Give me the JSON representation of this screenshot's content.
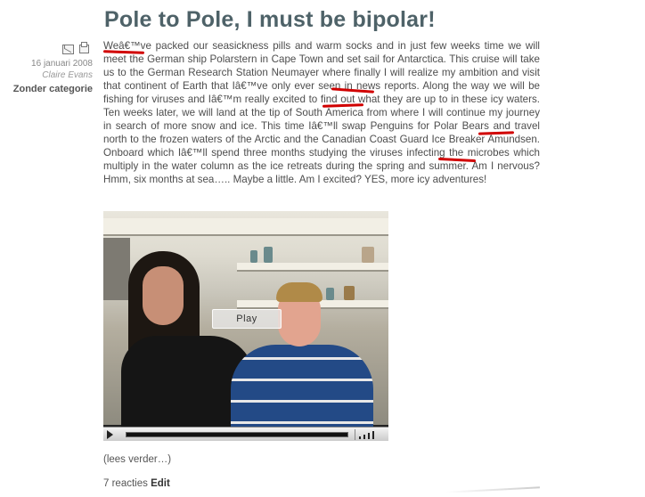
{
  "post": {
    "title": "Pole to Pole, I must be bipolar!",
    "body": "Weâ€™ve packed our seasickness pills and warm socks and in just few weeks time we will meet the German ship Polarstern in Cape Town and set sail for Antarctica. This cruise will take us to the German Research Station Neumayer where finally I will realize my ambition and visit that continent of Earth that Iâ€™ve only ever seen in news reports. Along the way we will be fishing for viruses and Iâ€™m really excited to find out what they are up to in these icy waters. Ten weeks later, we will land at the tip of South America from where I will continue my journey in search of more snow and ice. This time Iâ€™ll swap Penguins for Polar Bears and travel north to the frozen waters of the Arctic and the Canadian Coast Guard Ice Breaker Amundsen. Onboard which Iâ€™ll spend three months studying the viruses infecting the microbes which multiply in the water column as the ice retreats during the spring and summer. Am I nervous? Hmm, six months at sea….. Maybe a little. Am I excited? YES, more icy adventures!",
    "date": "16 januari 2008",
    "author": "Claire Evans",
    "category": "Zonder categorie",
    "read_more": "(lees verder…)",
    "comments": "7 reacties",
    "edit": "Edit"
  },
  "video": {
    "play_label": "Play"
  },
  "icons": {
    "email": "envelope-icon",
    "print": "printer-icon"
  },
  "colors": {
    "title": "#4e6268",
    "underline": "#d10000"
  }
}
